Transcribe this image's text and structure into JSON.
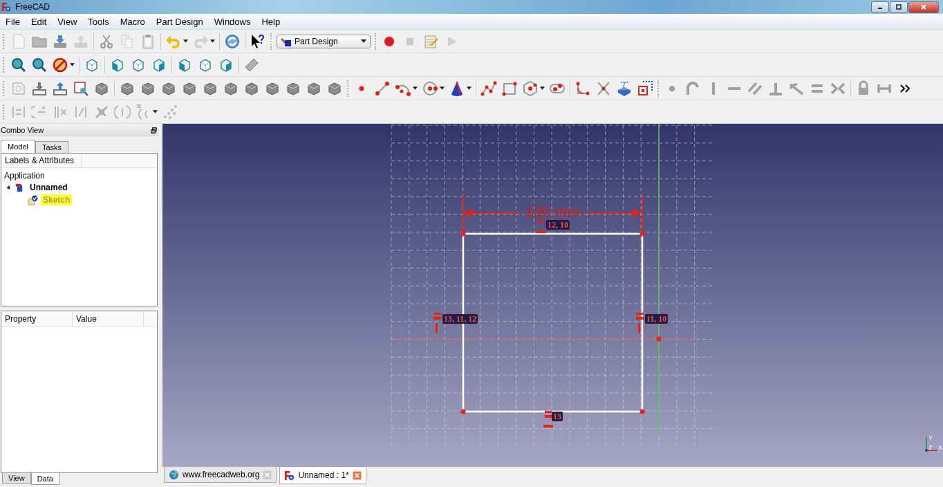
{
  "window": {
    "title": "FreeCAD"
  },
  "menu": [
    "File",
    "Edit",
    "View",
    "Tools",
    "Macro",
    "Part Design",
    "Windows",
    "Help"
  ],
  "workbench_selector": {
    "value": "Part Design"
  },
  "combo_view": {
    "title": "Combo View",
    "tabs": [
      {
        "label": "Model",
        "selected": true
      },
      {
        "label": "Tasks",
        "selected": false
      }
    ],
    "tree": {
      "header": "Labels & Attributes",
      "root": "Application",
      "items": [
        {
          "label": "Unnamed",
          "expanded": true,
          "selected": false,
          "children": [
            {
              "label": "Sketch",
              "selected": true
            }
          ]
        }
      ]
    },
    "property_table": {
      "columns": [
        "Property",
        "Value"
      ]
    },
    "bottom_tabs": [
      {
        "label": "View",
        "selected": false
      },
      {
        "label": "Data",
        "selected": true
      }
    ]
  },
  "sketch": {
    "dimension": "100 mm",
    "constraint_labels": [
      "12, 10",
      "13, 11, 12",
      "11, 10",
      "13"
    ]
  },
  "axis_indicator": {
    "labels": [
      "Y",
      "Z",
      "X"
    ]
  },
  "document_tabs": [
    {
      "label": "www.freecadweb.org",
      "kind": "web",
      "selected": false
    },
    {
      "label": "Unnamed : 1*",
      "kind": "document",
      "selected": true
    }
  ]
}
